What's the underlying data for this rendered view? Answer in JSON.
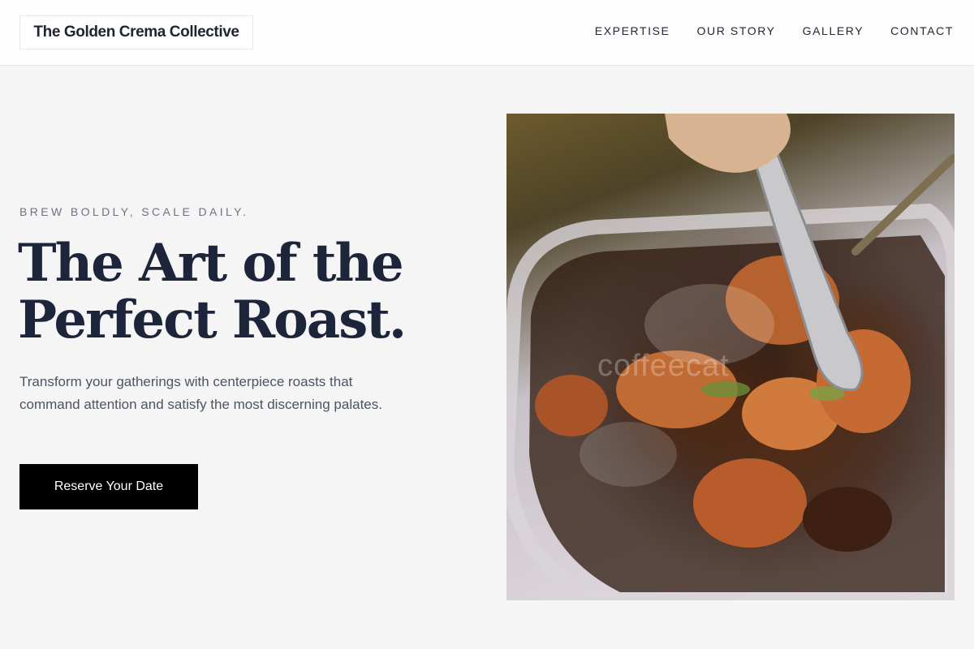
{
  "header": {
    "logo_text": "The Golden Crema Collective",
    "nav": [
      {
        "label": "EXPERTISE"
      },
      {
        "label": "OUR STORY"
      },
      {
        "label": "GALLERY"
      },
      {
        "label": "CONTACT"
      }
    ]
  },
  "hero": {
    "eyebrow": "BREW BOLDLY, SCALE DAILY.",
    "headline_line1": "The Art of the",
    "headline_line2": "Perfect Roast.",
    "lead": "Transform your gatherings with centerpiece roasts that command attention and satisfy the most discerning palates.",
    "cta_label": "Reserve Your Date",
    "image_watermark": "coffeecat"
  },
  "colors": {
    "background": "#f5f5f5",
    "headline": "#1c2539",
    "cta_background": "#000000",
    "eyebrow": "#6b7385"
  }
}
